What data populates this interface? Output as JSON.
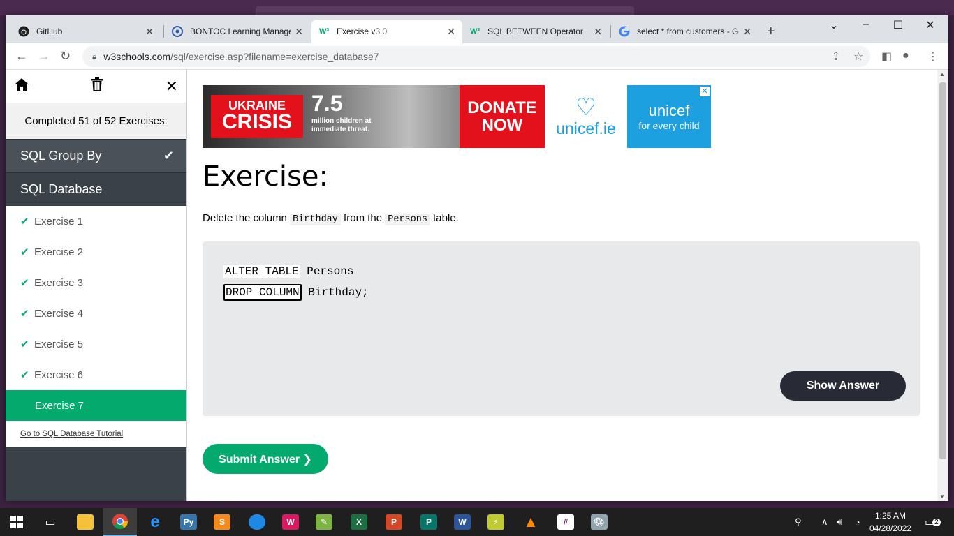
{
  "tabs": [
    {
      "title": "GitHub",
      "icon": "github-icon",
      "active": false
    },
    {
      "title": "BONTOC Learning Managem",
      "icon": "moodle-icon",
      "active": false
    },
    {
      "title": "Exercise v3.0",
      "icon": "w3schools-icon",
      "active": true
    },
    {
      "title": "SQL BETWEEN Operator",
      "icon": "w3schools-icon",
      "active": false
    },
    {
      "title": "select * from customers - Go",
      "icon": "google-icon",
      "active": false
    }
  ],
  "address": {
    "domain": "w3schools.com",
    "path": "/sql/exercise.asp?filename=exercise_database7"
  },
  "sidebar": {
    "progress": "Completed 51 of 52 Exercises:",
    "categories": [
      {
        "label": "SQL Group By",
        "checked": true
      },
      {
        "label": "SQL Database",
        "checked": false
      }
    ],
    "items": [
      {
        "label": "Exercise 1",
        "done": true
      },
      {
        "label": "Exercise 2",
        "done": true
      },
      {
        "label": "Exercise 3",
        "done": true
      },
      {
        "label": "Exercise 4",
        "done": true
      },
      {
        "label": "Exercise 5",
        "done": true
      },
      {
        "label": "Exercise 6",
        "done": true
      },
      {
        "label": "Exercise 7",
        "done": false,
        "active": true
      }
    ],
    "tutorial_link": "Go to SQL Database Tutorial"
  },
  "ad": {
    "badge_line1": "UKRAINE",
    "badge_line2": "CRISIS",
    "number": "7.5",
    "subtext": "million children at immediate threat.",
    "donate_line1": "DONATE",
    "donate_line2": "NOW",
    "unicef_ie": "unicef.ie",
    "unicef": "unicef",
    "unicef_tag": "for every child"
  },
  "exercise": {
    "title": "Exercise:",
    "desc_pre": "Delete the column ",
    "desc_code1": "Birthday",
    "desc_mid": " from the ",
    "desc_code2": "Persons",
    "desc_post": " table.",
    "line1_kw": "ALTER TABLE",
    "line1_rest": " Persons",
    "line2_input": "DROP COLUMN",
    "line2_rest": " Birthday;",
    "show_answer": "Show Answer",
    "submit": "Submit Answer ❯"
  },
  "taskbar": {
    "time": "1:25 AM",
    "date": "04/28/2022",
    "notifications": "2"
  },
  "colors": {
    "accent_green": "#04aa6d",
    "sidebar_dark": "#3a4148",
    "button_dark": "#282a35",
    "unicef_blue": "#1ca0e0",
    "crisis_red": "#e3111b"
  }
}
